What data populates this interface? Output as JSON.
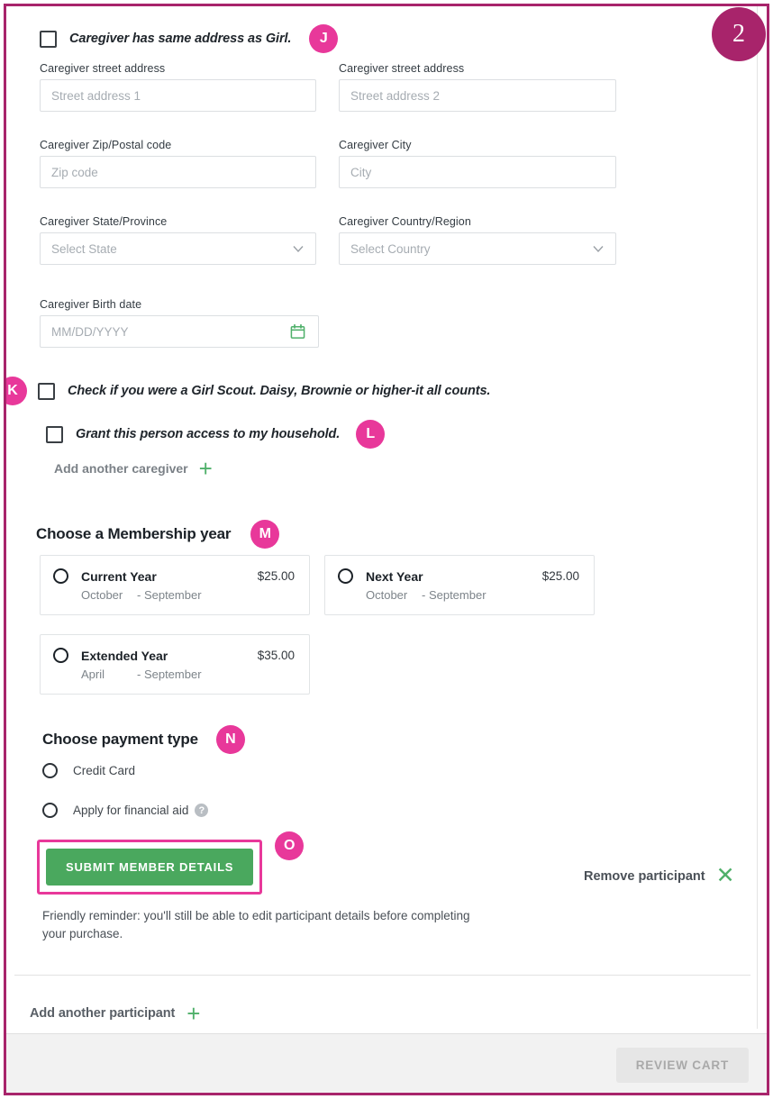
{
  "annotations": {
    "j": "J",
    "k": "K",
    "l": "L",
    "m": "M",
    "n": "N",
    "o": "O",
    "step": "2"
  },
  "colors": {
    "annotation_pink": "#e8389a",
    "frame_magenta": "#a8246b",
    "action_green": "#4aa85e",
    "icon_green": "#4fb06a"
  },
  "caregiver": {
    "same_address_checkbox_label": "Caregiver has same address as Girl.",
    "fields": [
      {
        "label": "Caregiver street address",
        "placeholder": "Street address 1",
        "value": "",
        "type": "text"
      },
      {
        "label": "Caregiver street address",
        "placeholder": "Street address 2",
        "value": "",
        "type": "text"
      },
      {
        "label": "Caregiver Zip/Postal code",
        "placeholder": "Zip code",
        "value": "",
        "type": "text"
      },
      {
        "label": "Caregiver City",
        "placeholder": "City",
        "value": "",
        "type": "text"
      },
      {
        "label": "Caregiver State/Province",
        "placeholder": "Select State",
        "value": "",
        "type": "select"
      },
      {
        "label": "Caregiver Country/Region",
        "placeholder": "Select Country",
        "value": "",
        "type": "select"
      },
      {
        "label": "Caregiver Birth date",
        "placeholder": "MM/DD/YYYY",
        "value": "",
        "type": "date"
      }
    ],
    "girl_scout_checkbox_label": "Check if you were a Girl Scout. Daisy, Brownie or higher-it all counts.",
    "household_access_checkbox_label": "Grant this person access to my household.",
    "add_another_label": "Add another caregiver"
  },
  "membership": {
    "title": "Choose a Membership year",
    "options": [
      {
        "name": "Current Year",
        "price": "$25.00",
        "start": "October",
        "end": "- September",
        "selected": false
      },
      {
        "name": "Next Year",
        "price": "$25.00",
        "start": "October",
        "end": "- September",
        "selected": false
      },
      {
        "name": "Extended Year",
        "price": "$35.00",
        "start": "April",
        "end": "- September",
        "selected": false
      }
    ]
  },
  "payment": {
    "title": "Choose payment type",
    "options": [
      {
        "label": "Credit Card",
        "selected": false,
        "help": false
      },
      {
        "label": "Apply for financial aid",
        "selected": false,
        "help": true
      }
    ],
    "help_glyph": "?"
  },
  "actions": {
    "submit_label": "SUBMIT MEMBER DETAILS",
    "remove_participant_label": "Remove participant",
    "remove_glyph": "✕",
    "reminder": "Friendly reminder: you'll still be able to edit participant details before completing your purchase.",
    "add_participant_label": "Add another participant",
    "plus_glyph": "+",
    "review_cart_label": "REVIEW CART"
  }
}
